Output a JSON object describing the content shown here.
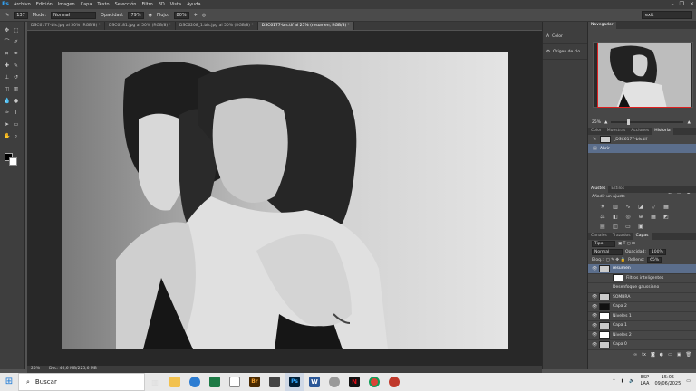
{
  "menu": {
    "logo": "Ps",
    "items": [
      "Archivo",
      "Edición",
      "Imagen",
      "Capa",
      "Texto",
      "Selección",
      "Filtro",
      "3D",
      "Vista",
      "Ayuda"
    ],
    "window_controls": [
      "–",
      "❐",
      "✕"
    ]
  },
  "options": {
    "size": "137",
    "mode_label": "Modo:",
    "mode_value": "Normal",
    "opacity_label": "Opacidad:",
    "opacity_value": "79%",
    "flow_label": "Flujo:",
    "flow_value": "80%",
    "workspace": "exit"
  },
  "tabs": [
    {
      "label": "DSC6177-bis.jpg al 50% (RGB/8) *",
      "active": false
    },
    {
      "label": "DSC6181.jpg al 50% (RGB/8) *",
      "active": false
    },
    {
      "label": "DSC6208_1.bis.jpg al 50% (RGB/8) *",
      "active": false
    },
    {
      "label": "DSC6177-bis.tif al 25% (resumen, RGB/8) *",
      "active": true
    }
  ],
  "status": {
    "zoom": "25%",
    "doc": "Doc: 46,6 MB/225,6 MB"
  },
  "midcol": [
    {
      "icon": "A",
      "label": "Color"
    },
    {
      "icon": "⚙",
      "label": "Origen de clo..."
    }
  ],
  "navigator": {
    "tabs": [
      "Navegador"
    ],
    "zoom": "25%"
  },
  "history": {
    "tabs": [
      "Color",
      "Muestras",
      "Acciones",
      "Historia"
    ],
    "active_tab": "Historia",
    "snapshot": "_DSC6177-bis.tif",
    "items": [
      "Abrir"
    ]
  },
  "adjustments": {
    "tabs": [
      "Ajustes",
      "Estilos"
    ],
    "add_label": "Añadir un ajuste"
  },
  "layers": {
    "tabs": [
      "Canales",
      "Trazados",
      "Capas"
    ],
    "active_tab": "Capas",
    "kind": "Tipo",
    "blend": "Normal",
    "opacity_label": "Opacidad:",
    "opacity_value": "100%",
    "lock_label": "Bloq.:",
    "fill_label": "Relleno:",
    "fill_value": "65%",
    "list": [
      {
        "name": "resumen",
        "selected": true,
        "thumb": "photo",
        "indent": false
      },
      {
        "name": "Filtros inteligentes",
        "selected": false,
        "thumb": "white",
        "indent": true
      },
      {
        "name": "Desenfoque gaussiano",
        "selected": false,
        "thumb": "none",
        "indent": true
      },
      {
        "name": "SOMBRA",
        "selected": false,
        "thumb": "photo",
        "indent": false
      },
      {
        "name": "Capa 2",
        "selected": false,
        "thumb": "dark",
        "indent": false
      },
      {
        "name": "Niveles 1",
        "selected": false,
        "thumb": "white",
        "indent": false
      },
      {
        "name": "Capa 1",
        "selected": false,
        "thumb": "photo",
        "indent": false
      },
      {
        "name": "Niveles 2",
        "selected": false,
        "thumb": "white",
        "indent": false
      },
      {
        "name": "Capa 0",
        "selected": false,
        "thumb": "photo",
        "indent": false
      }
    ]
  },
  "taskbar": {
    "search_placeholder": "Buscar",
    "lang": "ESP",
    "lang2": "LAA",
    "time": "15:05",
    "date": "09/06/2025"
  }
}
